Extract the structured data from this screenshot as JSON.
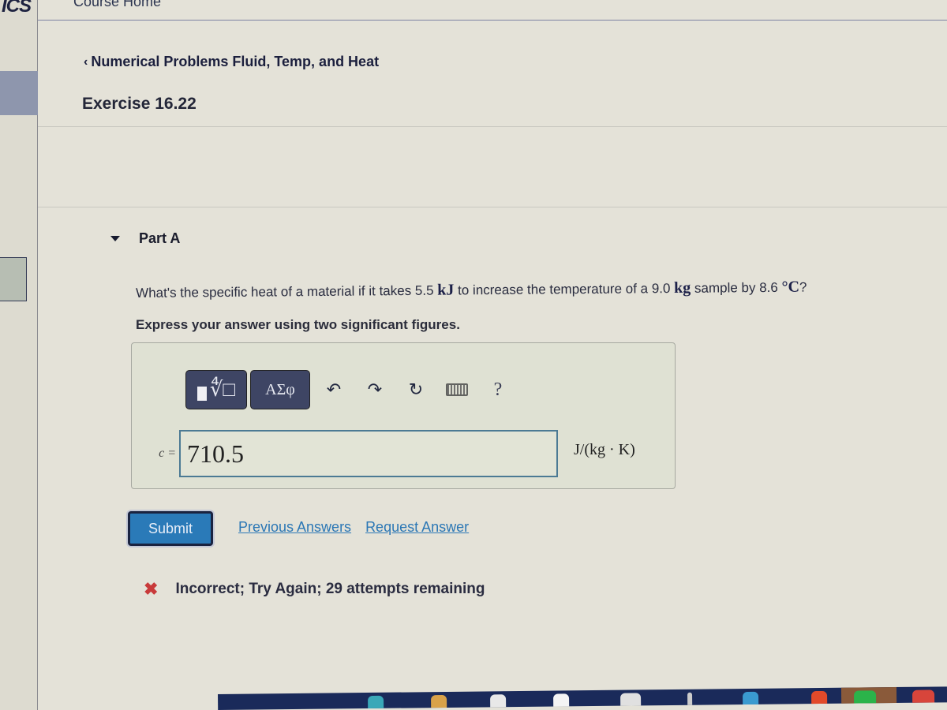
{
  "sidebar": {
    "brand": "ICS"
  },
  "topnav": {
    "course_home": "Course Home"
  },
  "breadcrumb": {
    "chevron": "‹",
    "label": "Numerical Problems Fluid, Temp, and Heat"
  },
  "page_title": "Exercise 16.22",
  "part": {
    "label": "Part A",
    "expanded": true
  },
  "question": {
    "pre1": "What's the specific heat of a material if it takes 5.5 ",
    "unit1": "kJ",
    "pre2": " to increase the temperature of a 9.0 ",
    "unit2": "kg",
    "pre3": " sample by 8.6 ",
    "unit3": "°C",
    "post": "?"
  },
  "instruction": "Express your answer using two significant figures.",
  "toolbar": {
    "templates_icon": "templates-icon",
    "greek_label": "ΑΣφ",
    "undo": "↶",
    "redo": "↷",
    "reset": "↻",
    "keyboard_icon": "keyboard-icon",
    "help": "?"
  },
  "answer": {
    "variable": "c =",
    "value": "710.5",
    "units": "J/(kg · K)"
  },
  "actions": {
    "submit": "Submit",
    "previous_answers": "Previous Answers",
    "request_answer": "Request Answer"
  },
  "feedback": {
    "icon": "✖",
    "text": "Incorrect; Try Again; 29 attempts remaining",
    "color": "#c83a3a"
  },
  "taskbar": {
    "icons": [
      "edge-icon",
      "file-explorer-icon",
      "store-icon",
      "word-icon",
      "people-icon",
      "pen-icon",
      "app-icon",
      "office-icon",
      "spotify-icon",
      "chrome-icon"
    ]
  }
}
